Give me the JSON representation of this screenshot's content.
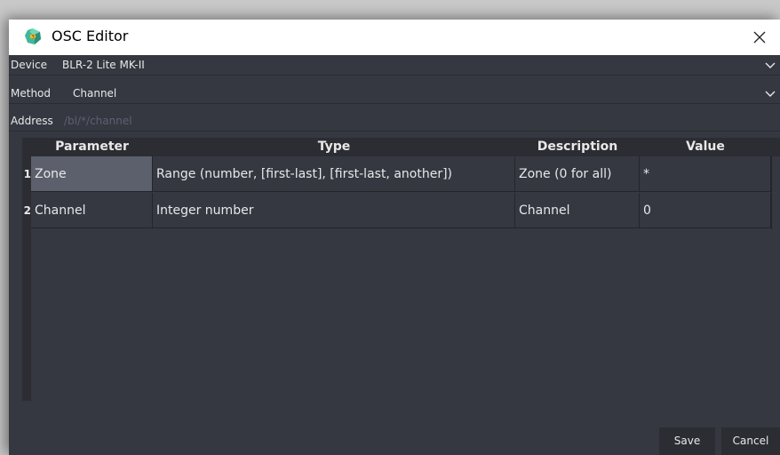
{
  "window": {
    "title": "OSC Editor"
  },
  "form": {
    "device": {
      "label": "Device",
      "value": "BLR-2 Lite MK-II"
    },
    "method": {
      "label": "Method",
      "value": "Channel"
    },
    "address": {
      "label": "Address",
      "placeholder": "/bl/*/channel"
    }
  },
  "table": {
    "headers": [
      "Parameter",
      "Type",
      "Description",
      "Value"
    ],
    "rows": [
      {
        "num": "1",
        "parameter": "Zone",
        "type": "Range (number, [first-last], [first-last, another])",
        "description": "Zone (0 for all)",
        "value": "*"
      },
      {
        "num": "2",
        "parameter": "Channel",
        "type": "Integer number",
        "description": "Channel",
        "value": "0"
      }
    ]
  },
  "buttons": {
    "save": "Save",
    "cancel": "Cancel"
  },
  "colors": {
    "background": "#353841",
    "header": "#2b2d33",
    "selected_cell": "#5b606c",
    "text": "#e8e8e8",
    "placeholder": "#5d6170"
  },
  "icons": {
    "app": "app-icon",
    "close": "close-icon",
    "dropdown": "chevron-down-icon"
  }
}
